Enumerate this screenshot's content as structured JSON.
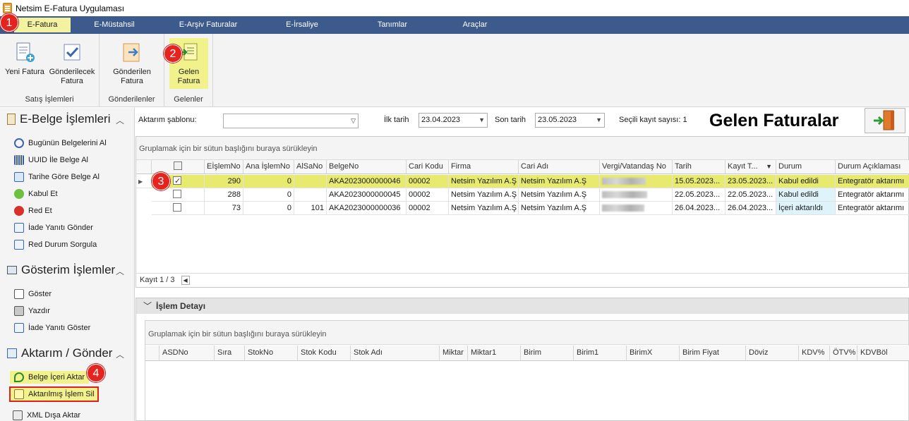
{
  "window": {
    "title": "Netsim E-Fatura Uygulaması"
  },
  "menu": {
    "tabs": [
      "E-Fatura",
      "E-Müstahsil",
      "E-Arşiv Faturalar",
      "E-İrsaliye",
      "Tanımlar",
      "Araçlar"
    ],
    "active": "E-Fatura"
  },
  "ribbon": {
    "groups": [
      {
        "label": "Satış İşlemleri",
        "buttons": [
          "Yeni Fatura",
          "Gönderilecek\nFatura"
        ]
      },
      {
        "label": "Gönderilenler",
        "buttons": [
          "Gönderilen\nFatura"
        ]
      },
      {
        "label": "Gelenler",
        "buttons": [
          "Gelen\nFatura"
        ]
      }
    ],
    "b1": "Yeni Fatura",
    "b2a": "Gönderilecek",
    "b2b": "Fatura",
    "b3a": "Gönderilen",
    "b3b": "Fatura",
    "b4a": "Gelen",
    "b4b": "Fatura",
    "g1": "Satış İşlemleri",
    "g2": "Gönderilenler",
    "g3": "Gelenler"
  },
  "badges": {
    "b1": "1",
    "b2": "2",
    "b3": "3",
    "b4": "4"
  },
  "sidebar": {
    "sec1": "E-Belge İşlemleri",
    "sec1_items": [
      "Bugünün Belgelerini Al",
      "UUID İle Belge Al",
      "Tarihe Göre Belge Al",
      "Kabul Et",
      "Red Et",
      "İade Yanıtı Gönder",
      "Red Durum Sorgula"
    ],
    "sec2": "Gösterim İşlemler",
    "sec2_items": [
      "Göster",
      "Yazdır",
      "İade Yanıtı Göster"
    ],
    "sec3": "Aktarım / Gönder",
    "sec3_items": [
      "Belge İçeri Aktar",
      "Aktarılmış İşlem Sil",
      "XML Dışa Aktar"
    ]
  },
  "filters": {
    "template_label": "Aktarım şablonu:",
    "template_value": "",
    "start_label": "İlk tarih",
    "start_value": "23.04.2023",
    "end_label": "Son tarih",
    "end_value": "23.05.2023",
    "selected_label": "Seçili kayıt sayısı: 1"
  },
  "page_title": "Gelen Faturalar",
  "grid": {
    "group_hint": "Gruplamak için bir sütun başlığını buraya sürükleyin",
    "columns": [
      "EİşlemNo",
      "Ana İşlemNo",
      "AlSaNo",
      "BelgeNo",
      "Cari Kodu",
      "Firma",
      "Cari Adı",
      "Vergi/Vatandaş No",
      "Tarih",
      "Kayıt T...",
      "Durum",
      "Durum Açıklaması"
    ],
    "rows": [
      {
        "checked": true,
        "eislem": "290",
        "ana": "0",
        "alsa": "",
        "belge": "AKA2023000000046",
        "cari_kodu": "00002",
        "firma": "Netsim Yazılım A.Ş",
        "cari_adi": "Netsim Yazılım A.Ş",
        "tarih": "15.05.2023...",
        "kayit": "23.05.2023...",
        "durum": "Kabul edildi",
        "aciklama": "Entegratör aktarımı"
      },
      {
        "checked": false,
        "eislem": "288",
        "ana": "0",
        "alsa": "",
        "belge": "AKA2023000000045",
        "cari_kodu": "00002",
        "firma": "Netsim Yazılım A.Ş",
        "cari_adi": "Netsim Yazılım A.Ş",
        "tarih": "22.05.2023...",
        "kayit": "22.05.2023...",
        "durum": "Kabul edildi",
        "aciklama": "Entegratör aktarımı"
      },
      {
        "checked": false,
        "eislem": "73",
        "ana": "0",
        "alsa": "101",
        "belge": "AKA2023000000036",
        "cari_kodu": "00002",
        "firma": "Netsim Yazılım A.Ş",
        "cari_adi": "Netsim Yazılım A.Ş",
        "tarih": "26.04.2023...",
        "kayit": "26.04.2023...",
        "durum": "İçeri aktarıldı",
        "aciklama": "Entegratör aktarımı"
      }
    ],
    "footer": "Kayıt 1 / 3"
  },
  "detail": {
    "title": "İşlem Detayı",
    "group_hint": "Gruplamak için bir sütun başlığını buraya sürükleyin",
    "columns": [
      "ASDNo",
      "Sıra",
      "StokNo",
      "Stok Kodu",
      "Stok Adı",
      "Miktar",
      "Miktar1",
      "Birim",
      "Birim1",
      "BirimX",
      "Birim Fiyat",
      "Döviz",
      "KDV%",
      "ÖTV%",
      "KDVBöl"
    ]
  },
  "colors": {
    "menubar": "#3c5a8c",
    "highlight": "#f2f28c",
    "badge": "#e52420",
    "selected_row": "#e7ea6e"
  }
}
